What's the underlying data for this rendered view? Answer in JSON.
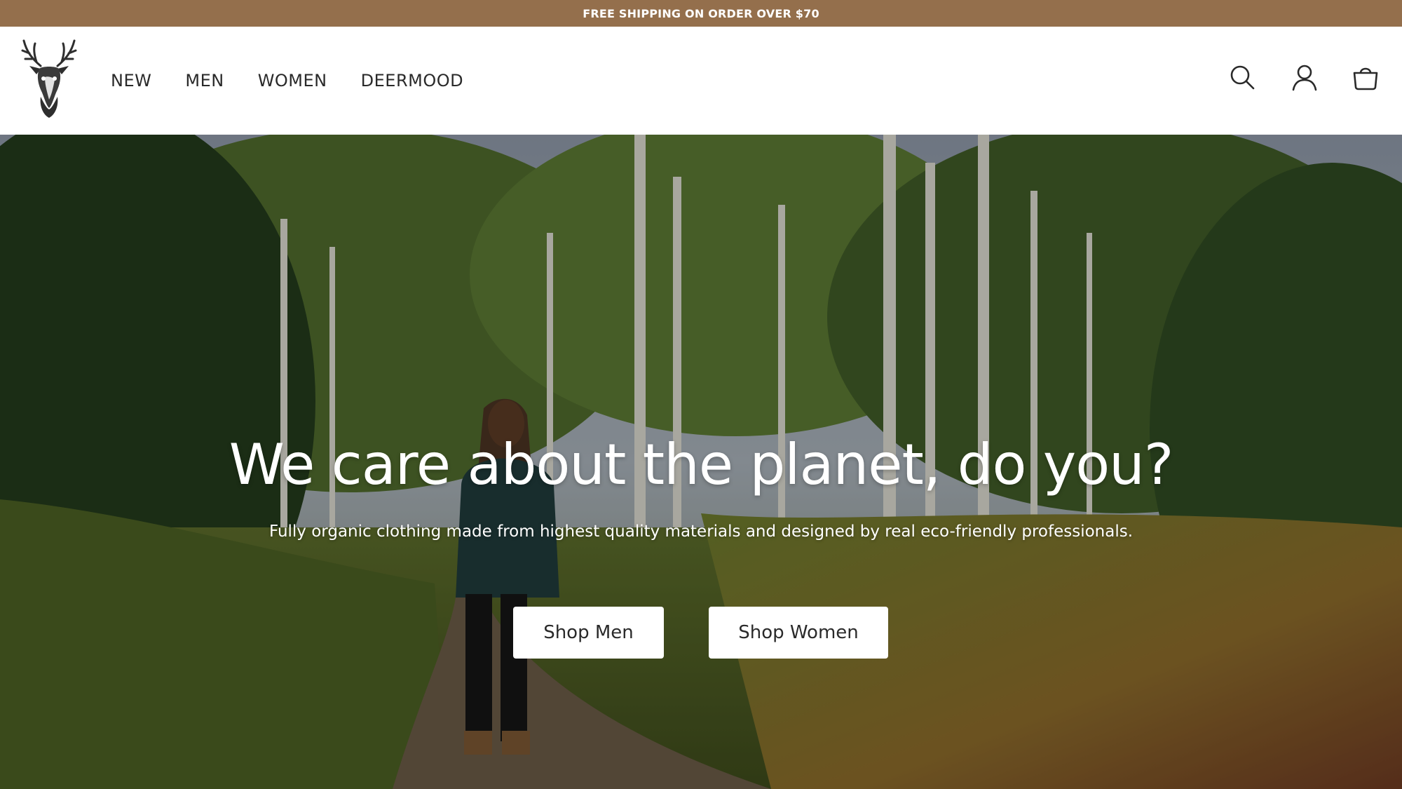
{
  "announcement": {
    "text": "FREE SHIPPING ON ORDER OVER $70"
  },
  "header": {
    "logo_name": "deer-head-logo",
    "nav": [
      {
        "label": "NEW"
      },
      {
        "label": "MEN"
      },
      {
        "label": "WOMEN"
      },
      {
        "label": "DEERMOOD"
      }
    ],
    "icons": [
      "search-icon",
      "account-icon",
      "cart-icon"
    ]
  },
  "hero": {
    "title": "We care about the planet, do you?",
    "subtitle": "Fully organic clothing made from highest quality materials and designed by real eco-friendly professionals.",
    "buttons": [
      {
        "label": "Shop Men"
      },
      {
        "label": "Shop Women"
      }
    ]
  },
  "colors": {
    "announcement_bg": "#946f4c",
    "button_bg": "#ffffff",
    "text_dark": "#2a2a2a"
  }
}
